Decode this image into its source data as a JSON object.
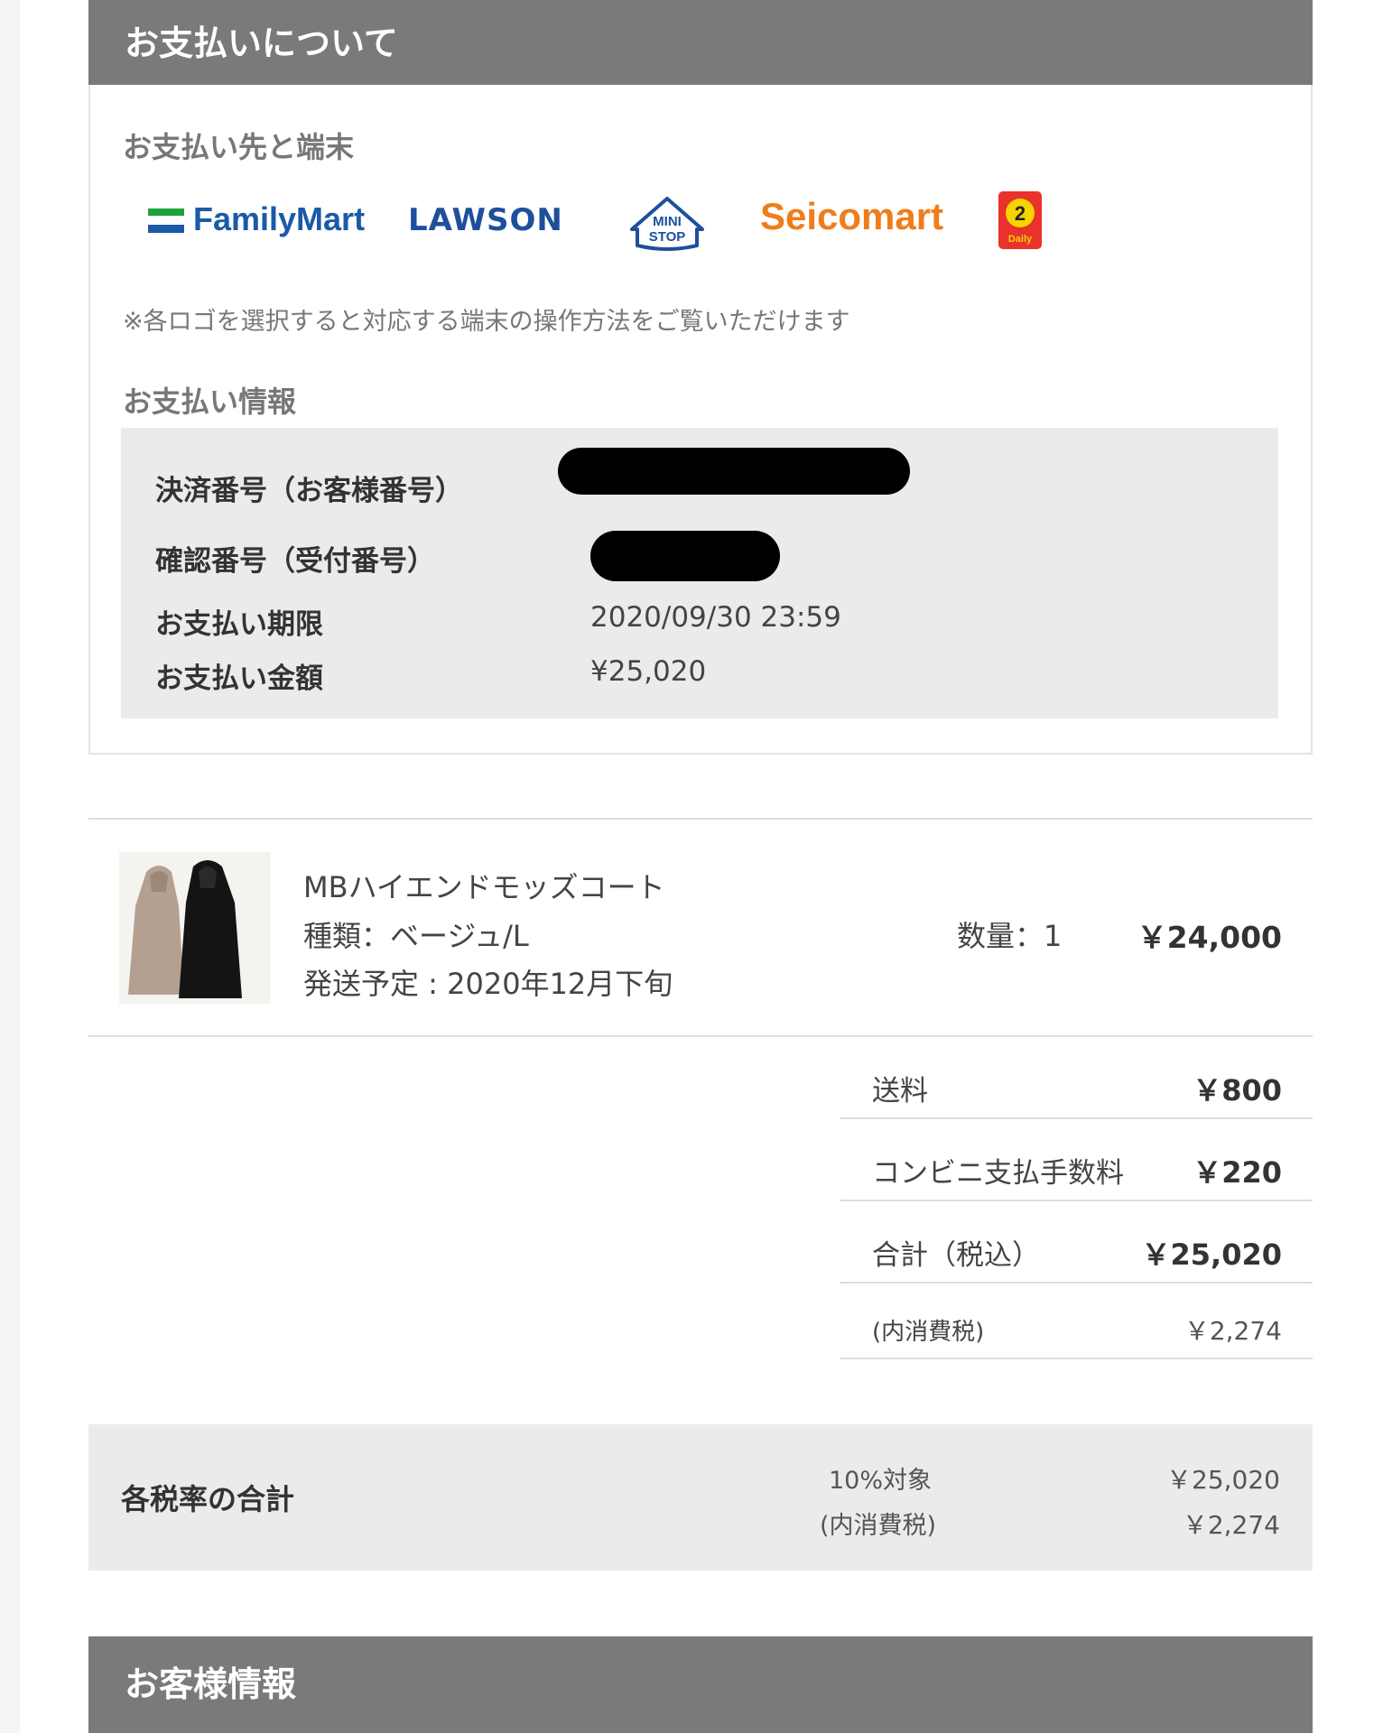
{
  "payment_section": {
    "title": "お支払いについて",
    "stores_label": "お支払い先と端末",
    "stores": [
      {
        "name": "FamilyMart",
        "icon": "familymart-logo"
      },
      {
        "name": "LAWSON",
        "icon": "lawson-logo"
      },
      {
        "name": "MINI STOP",
        "icon": "ministop-logo"
      },
      {
        "name": "Seicomart",
        "icon": "seicomart-logo"
      },
      {
        "name": "Daily",
        "icon": "daily-yamazaki-logo"
      }
    ],
    "note": "※各ロゴを選択すると対応する端末の操作方法をご覧いただけます",
    "info_label": "お支払い情報",
    "info": {
      "settlement_number_label": "決済番号（お客様番号）",
      "confirmation_number_label": "確認番号（受付番号）",
      "deadline_label": "お支払い期限",
      "deadline_value": "2020/09/30 23:59",
      "amount_label": "お支払い金額",
      "amount_value": "¥25,020"
    }
  },
  "order_item": {
    "name": "MBハイエンドモッズコート",
    "variant": "種類：ベージュ/L",
    "shipping": "発送予定 : 2020年12月下旬",
    "quantity": "数量：1",
    "price": "￥24,000"
  },
  "summary": {
    "shipping_label": "送料",
    "shipping_value": "￥800",
    "fee_label": "コンビニ支払手数料",
    "fee_value": "￥220",
    "total_label": "合計（税込）",
    "total_value": "￥25,020",
    "tax_label": "(内消費税)",
    "tax_value": "￥2,274"
  },
  "tax_rates": {
    "title": "各税率の合計",
    "rate_label": "10%対象",
    "rate_value": "￥25,020",
    "tax_label": "(内消費税)",
    "tax_value": "￥2,274"
  },
  "customer_section": {
    "title": "お客様情報"
  },
  "colors": {
    "header_bar": "#7a7a7a",
    "panel": "#ebebeb",
    "familymart_blue": "#1b5aa6",
    "familymart_green": "#1ea03b",
    "seicomart_orange": "#ef7d1a",
    "daily_red": "#e8322b"
  }
}
